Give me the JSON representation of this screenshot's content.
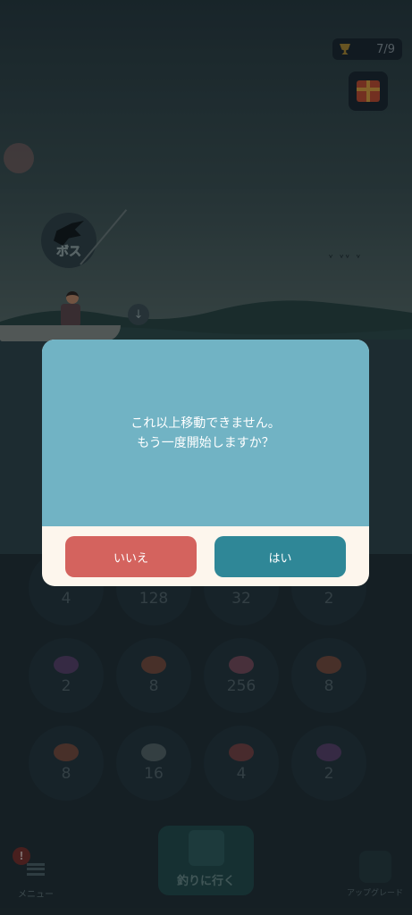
{
  "header": {
    "trophy_count": "7/9"
  },
  "boss": {
    "label": "ボス"
  },
  "fish_grid": [
    {
      "count": "4",
      "color": "#7a4040"
    },
    {
      "count": "128",
      "color": "#4a4a4a"
    },
    {
      "count": "32",
      "color": "#3a6a70"
    },
    {
      "count": "2",
      "color": "#5a3f6a"
    },
    {
      "count": "2",
      "color": "#5a3f6a"
    },
    {
      "count": "8",
      "color": "#7a4a3a"
    },
    {
      "count": "256",
      "color": "#7a4a5a"
    },
    {
      "count": "8",
      "color": "#7a4a3a"
    },
    {
      "count": "8",
      "color": "#7a4a3a"
    },
    {
      "count": "16",
      "color": "#566466"
    },
    {
      "count": "4",
      "color": "#7a4040"
    },
    {
      "count": "2",
      "color": "#5a3f6a"
    }
  ],
  "dialog": {
    "line1": "これ以上移動できません。",
    "line2": "もう一度開始しますか？",
    "no_label": "いいえ",
    "yes_label": "はい"
  },
  "bottom": {
    "menu_label": "メニュー",
    "menu_badge": "!",
    "go_label": "釣りに行く",
    "upgrade_label": "アップグレード"
  }
}
